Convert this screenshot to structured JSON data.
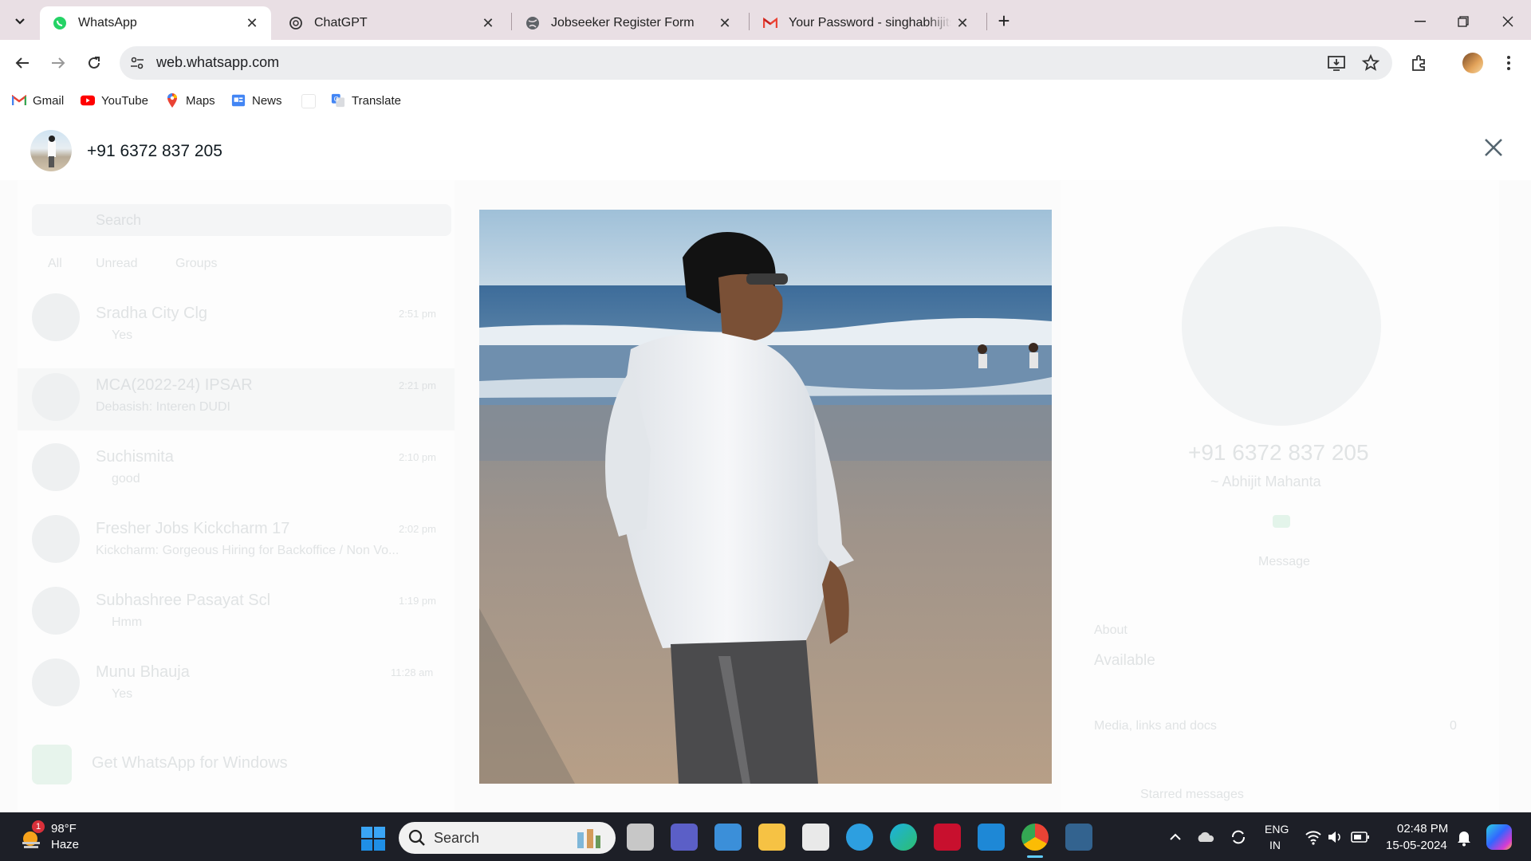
{
  "browser": {
    "tabs": [
      {
        "title": "WhatsApp",
        "active": true,
        "icon": "whatsapp-icon"
      },
      {
        "title": "ChatGPT",
        "active": false,
        "icon": "chatgpt-icon"
      },
      {
        "title": "Jobseeker Register Form",
        "active": false,
        "icon": "globe-icon"
      },
      {
        "title": "Your Password - singhabhijitsing",
        "active": false,
        "icon": "gmail-icon"
      }
    ],
    "url": "web.whatsapp.com",
    "bookmarks": [
      {
        "label": "Gmail",
        "icon": "gmail-icon"
      },
      {
        "label": "YouTube",
        "icon": "youtube-icon"
      },
      {
        "label": "Maps",
        "icon": "maps-icon"
      },
      {
        "label": "News",
        "icon": "news-icon"
      },
      {
        "label": "Translate",
        "icon": "translate-icon"
      }
    ]
  },
  "viewer": {
    "contact": "+91 6372 837 205"
  },
  "background_app": {
    "search_placeholder": "Search",
    "filters": [
      "All",
      "Unread",
      "Groups"
    ],
    "chats": [
      {
        "name": "Sradha City Clg",
        "preview": "Yes",
        "time": "2:51 pm"
      },
      {
        "name": "MCA(2022-24) IPSAR",
        "preview": "Debasish: Interen DUDI",
        "time": "2:21 pm"
      },
      {
        "name": "Suchismita",
        "preview": "good",
        "time": "2:10 pm"
      },
      {
        "name": "Fresher Jobs Kickcharm 17",
        "preview": "Kickcharm: Gorgeous Hiring for Backoffice / Non Vo...",
        "time": "2:02 pm"
      },
      {
        "name": "Subhashree Pasayat Scl",
        "preview": "Hmm",
        "time": "1:19 pm"
      },
      {
        "name": "Munu Bhauja",
        "preview": "Yes",
        "time": "11:28 am"
      }
    ],
    "get_app": "Get WhatsApp for Windows",
    "profile_number": "+91 6372 837 205",
    "profile_name": "~ Abhijit Mahanta",
    "message_label": "Message",
    "about_label": "About",
    "about_value": "Available",
    "media_label": "Media, links and docs",
    "media_count": "0",
    "starred_label": "Starred messages"
  },
  "taskbar": {
    "weather_temp": "98°F",
    "weather_desc": "Haze",
    "weather_badge": "1",
    "search_label": "Search",
    "lang_line1": "ENG",
    "lang_line2": "IN",
    "time": "02:48 PM",
    "date": "15-05-2024"
  }
}
